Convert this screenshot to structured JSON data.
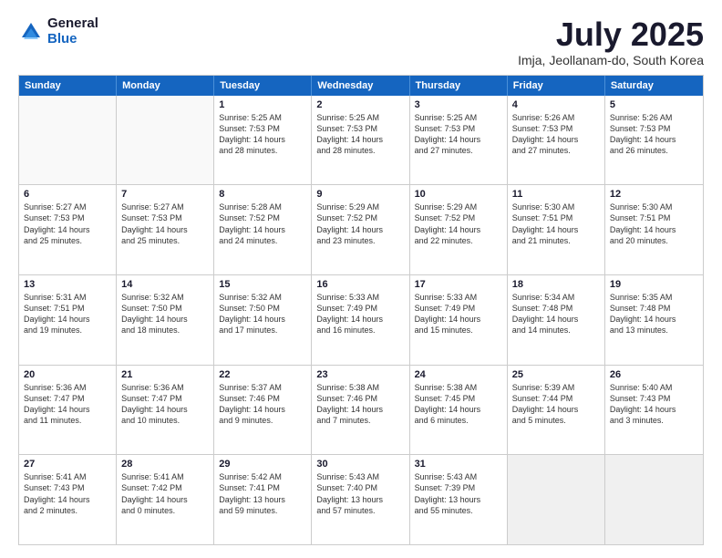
{
  "logo": {
    "general": "General",
    "blue": "Blue"
  },
  "title": "July 2025",
  "subtitle": "Imja, Jeollanam-do, South Korea",
  "header": {
    "days": [
      "Sunday",
      "Monday",
      "Tuesday",
      "Wednesday",
      "Thursday",
      "Friday",
      "Saturday"
    ]
  },
  "weeks": [
    [
      {
        "day": "",
        "lines": [],
        "empty": true
      },
      {
        "day": "",
        "lines": [],
        "empty": true
      },
      {
        "day": "1",
        "lines": [
          "Sunrise: 5:25 AM",
          "Sunset: 7:53 PM",
          "Daylight: 14 hours",
          "and 28 minutes."
        ]
      },
      {
        "day": "2",
        "lines": [
          "Sunrise: 5:25 AM",
          "Sunset: 7:53 PM",
          "Daylight: 14 hours",
          "and 28 minutes."
        ]
      },
      {
        "day": "3",
        "lines": [
          "Sunrise: 5:25 AM",
          "Sunset: 7:53 PM",
          "Daylight: 14 hours",
          "and 27 minutes."
        ]
      },
      {
        "day": "4",
        "lines": [
          "Sunrise: 5:26 AM",
          "Sunset: 7:53 PM",
          "Daylight: 14 hours",
          "and 27 minutes."
        ]
      },
      {
        "day": "5",
        "lines": [
          "Sunrise: 5:26 AM",
          "Sunset: 7:53 PM",
          "Daylight: 14 hours",
          "and 26 minutes."
        ]
      }
    ],
    [
      {
        "day": "6",
        "lines": [
          "Sunrise: 5:27 AM",
          "Sunset: 7:53 PM",
          "Daylight: 14 hours",
          "and 25 minutes."
        ]
      },
      {
        "day": "7",
        "lines": [
          "Sunrise: 5:27 AM",
          "Sunset: 7:53 PM",
          "Daylight: 14 hours",
          "and 25 minutes."
        ]
      },
      {
        "day": "8",
        "lines": [
          "Sunrise: 5:28 AM",
          "Sunset: 7:52 PM",
          "Daylight: 14 hours",
          "and 24 minutes."
        ]
      },
      {
        "day": "9",
        "lines": [
          "Sunrise: 5:29 AM",
          "Sunset: 7:52 PM",
          "Daylight: 14 hours",
          "and 23 minutes."
        ]
      },
      {
        "day": "10",
        "lines": [
          "Sunrise: 5:29 AM",
          "Sunset: 7:52 PM",
          "Daylight: 14 hours",
          "and 22 minutes."
        ]
      },
      {
        "day": "11",
        "lines": [
          "Sunrise: 5:30 AM",
          "Sunset: 7:51 PM",
          "Daylight: 14 hours",
          "and 21 minutes."
        ]
      },
      {
        "day": "12",
        "lines": [
          "Sunrise: 5:30 AM",
          "Sunset: 7:51 PM",
          "Daylight: 14 hours",
          "and 20 minutes."
        ]
      }
    ],
    [
      {
        "day": "13",
        "lines": [
          "Sunrise: 5:31 AM",
          "Sunset: 7:51 PM",
          "Daylight: 14 hours",
          "and 19 minutes."
        ]
      },
      {
        "day": "14",
        "lines": [
          "Sunrise: 5:32 AM",
          "Sunset: 7:50 PM",
          "Daylight: 14 hours",
          "and 18 minutes."
        ]
      },
      {
        "day": "15",
        "lines": [
          "Sunrise: 5:32 AM",
          "Sunset: 7:50 PM",
          "Daylight: 14 hours",
          "and 17 minutes."
        ]
      },
      {
        "day": "16",
        "lines": [
          "Sunrise: 5:33 AM",
          "Sunset: 7:49 PM",
          "Daylight: 14 hours",
          "and 16 minutes."
        ]
      },
      {
        "day": "17",
        "lines": [
          "Sunrise: 5:33 AM",
          "Sunset: 7:49 PM",
          "Daylight: 14 hours",
          "and 15 minutes."
        ]
      },
      {
        "day": "18",
        "lines": [
          "Sunrise: 5:34 AM",
          "Sunset: 7:48 PM",
          "Daylight: 14 hours",
          "and 14 minutes."
        ]
      },
      {
        "day": "19",
        "lines": [
          "Sunrise: 5:35 AM",
          "Sunset: 7:48 PM",
          "Daylight: 14 hours",
          "and 13 minutes."
        ]
      }
    ],
    [
      {
        "day": "20",
        "lines": [
          "Sunrise: 5:36 AM",
          "Sunset: 7:47 PM",
          "Daylight: 14 hours",
          "and 11 minutes."
        ]
      },
      {
        "day": "21",
        "lines": [
          "Sunrise: 5:36 AM",
          "Sunset: 7:47 PM",
          "Daylight: 14 hours",
          "and 10 minutes."
        ]
      },
      {
        "day": "22",
        "lines": [
          "Sunrise: 5:37 AM",
          "Sunset: 7:46 PM",
          "Daylight: 14 hours",
          "and 9 minutes."
        ]
      },
      {
        "day": "23",
        "lines": [
          "Sunrise: 5:38 AM",
          "Sunset: 7:46 PM",
          "Daylight: 14 hours",
          "and 7 minutes."
        ]
      },
      {
        "day": "24",
        "lines": [
          "Sunrise: 5:38 AM",
          "Sunset: 7:45 PM",
          "Daylight: 14 hours",
          "and 6 minutes."
        ]
      },
      {
        "day": "25",
        "lines": [
          "Sunrise: 5:39 AM",
          "Sunset: 7:44 PM",
          "Daylight: 14 hours",
          "and 5 minutes."
        ]
      },
      {
        "day": "26",
        "lines": [
          "Sunrise: 5:40 AM",
          "Sunset: 7:43 PM",
          "Daylight: 14 hours",
          "and 3 minutes."
        ]
      }
    ],
    [
      {
        "day": "27",
        "lines": [
          "Sunrise: 5:41 AM",
          "Sunset: 7:43 PM",
          "Daylight: 14 hours",
          "and 2 minutes."
        ]
      },
      {
        "day": "28",
        "lines": [
          "Sunrise: 5:41 AM",
          "Sunset: 7:42 PM",
          "Daylight: 14 hours",
          "and 0 minutes."
        ]
      },
      {
        "day": "29",
        "lines": [
          "Sunrise: 5:42 AM",
          "Sunset: 7:41 PM",
          "Daylight: 13 hours",
          "and 59 minutes."
        ]
      },
      {
        "day": "30",
        "lines": [
          "Sunrise: 5:43 AM",
          "Sunset: 7:40 PM",
          "Daylight: 13 hours",
          "and 57 minutes."
        ]
      },
      {
        "day": "31",
        "lines": [
          "Sunrise: 5:43 AM",
          "Sunset: 7:39 PM",
          "Daylight: 13 hours",
          "and 55 minutes."
        ]
      },
      {
        "day": "",
        "lines": [],
        "empty": true,
        "shaded": true
      },
      {
        "day": "",
        "lines": [],
        "empty": true,
        "shaded": true
      }
    ]
  ]
}
